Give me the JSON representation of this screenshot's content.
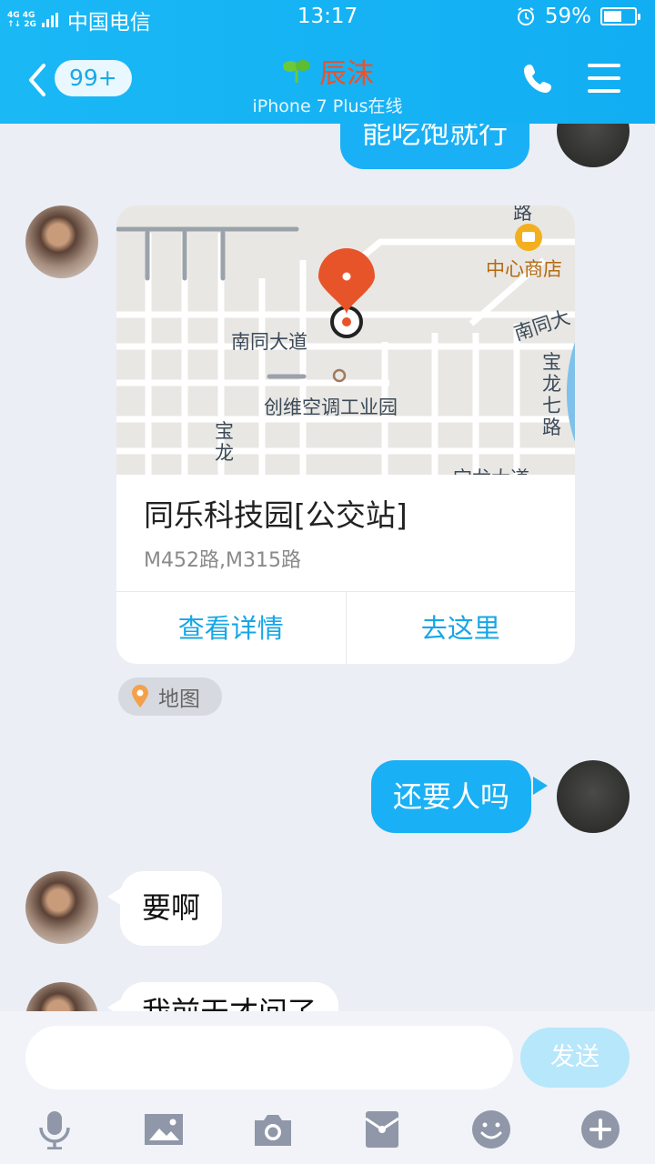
{
  "status_bar": {
    "signal_label": "4G 4G\n2G",
    "carrier": "中国电信",
    "time": "13:17",
    "battery": "59%",
    "battery_level": 0.59
  },
  "header": {
    "unread_count": "99+",
    "contact_name": "辰沫",
    "status": "iPhone 7 Plus在线"
  },
  "messages": {
    "top_right_partial": "能吃饱就行",
    "location_card": {
      "map_labels": {
        "road_1": "南同大道",
        "road_2": "南同大",
        "road_3": "宝龙七路",
        "road_4": "宝龙",
        "road_top": "路",
        "poi_1": "中心商店",
        "poi_2": "创维空调工业园",
        "bottom_partial": "宝龙大道"
      },
      "title": "同乐科技园[公交站]",
      "subtitle": "M452路,M315路",
      "action_details": "查看详情",
      "action_go": "去这里"
    },
    "map_tag": "地图",
    "right_msg": "还要人吗",
    "left_msg_1": "要啊",
    "left_msg_2_partial": "我前天才问了"
  },
  "input": {
    "placeholder": "",
    "send_label": "发送"
  },
  "toolbar": [
    "mic-icon",
    "image-icon",
    "camera-icon",
    "red-packet-icon",
    "emoji-icon",
    "plus-icon"
  ]
}
